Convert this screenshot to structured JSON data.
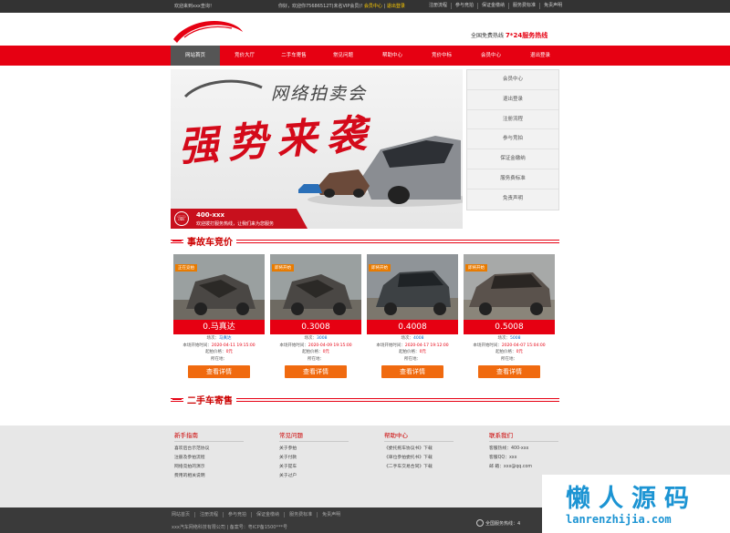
{
  "topbar": {
    "welcome": "欢迎来到xxx查询！",
    "hello": "你好，欢迎你75686512T(未名VIP会员)!",
    "member_center": "会员中心",
    "logout": "退出登录",
    "links": [
      "注册流程",
      "参与竞拍",
      "保证金缴纳",
      "服务费标准",
      "免责声明"
    ]
  },
  "header": {
    "hotline_label": "全国免费热线",
    "hotline_value": "7*24服务热线"
  },
  "nav": [
    "网站首页",
    "竞价大厅",
    "二手车寄售",
    "常见问题",
    "帮助中心",
    "竞价中标",
    "会员中心",
    "退出登录"
  ],
  "banner": {
    "title": "网络拍卖会",
    "slogan": "强势来袭",
    "phone": "400-xxx",
    "phone_desc": "欢迎拨打服务热线，让我们来为您服务"
  },
  "sidemenu": [
    "会员中心",
    "退出登录",
    "注册流程",
    "参与竞拍",
    "保证金缴纳",
    "服务费标准",
    "免责声明"
  ],
  "sections": {
    "accident": "事故车竞价",
    "used": "二手车寄售"
  },
  "cards": [
    {
      "tag": "正在竞拍",
      "price": "0.马真达",
      "lot_label": "场次：",
      "lot": "马真达",
      "start_label": "本场开始时间：",
      "start": "2020-04-11 19:15:00",
      "start_price_label": "起拍价格：",
      "start_price": "0元",
      "location_label": "所在地：",
      "location": "",
      "button": "查看详情"
    },
    {
      "tag": "即将开始",
      "price": "0.3008",
      "lot_label": "场次：",
      "lot": "3008",
      "start_label": "本场开始时间：",
      "start": "2020-04-09 19:15:00",
      "start_price_label": "起拍价格：",
      "start_price": "0元",
      "location_label": "所在地：",
      "location": "",
      "button": "查看详情"
    },
    {
      "tag": "即将开始",
      "price": "0.4008",
      "lot_label": "场次：",
      "lot": "4008",
      "start_label": "本场开始时间：",
      "start": "2020-04-17 19:12:00",
      "start_price_label": "起拍价格：",
      "start_price": "0元",
      "location_label": "所在地：",
      "location": "",
      "button": "查看详情"
    },
    {
      "tag": "即将开始",
      "price": "0.5008",
      "lot_label": "场次：",
      "lot": "5008",
      "start_label": "本场开始时间：",
      "start": "2020-04-07 15:04:00",
      "start_price_label": "起拍价格：",
      "start_price": "0元",
      "location_label": "所在地：",
      "location": "",
      "button": "查看详情"
    }
  ],
  "footer": {
    "cols": [
      {
        "title": "新手指南",
        "links": [
          "喜欢后台示范协议",
          "注册及参拍流程",
          "网络竞拍的演示",
          "费用的相关说明"
        ]
      },
      {
        "title": "常见问题",
        "links": [
          "关于参拍",
          "关于付款",
          "关于提车",
          "关于过户"
        ]
      },
      {
        "title": "帮助中心",
        "links": [
          "《委托拖车协议书》下载",
          "《单位参拍委托书》下载",
          "《二手车交易合同》下载"
        ]
      },
      {
        "title": "联系我们",
        "links": [
          "客服热线：400-xxx",
          "客服QQ：xxx",
          "邮 箱：xxx@qq.com"
        ]
      }
    ]
  },
  "bottom": {
    "links": [
      "网站首页",
      "注册流程",
      "参与竞拍",
      "保证金缴纳",
      "服务费标准",
      "免责声明"
    ],
    "copyright": "xxx汽车网络科技有限公司 | 备案号：粤ICP备1500***号",
    "service": "全国服务热线：4"
  },
  "watermark": {
    "cn": "懒人源码",
    "en": "lanrenzhijia.com"
  },
  "colors": {
    "brand_red": "#e60012",
    "button_orange": "#f06a0f",
    "watermark_blue": "#1c94d3"
  }
}
